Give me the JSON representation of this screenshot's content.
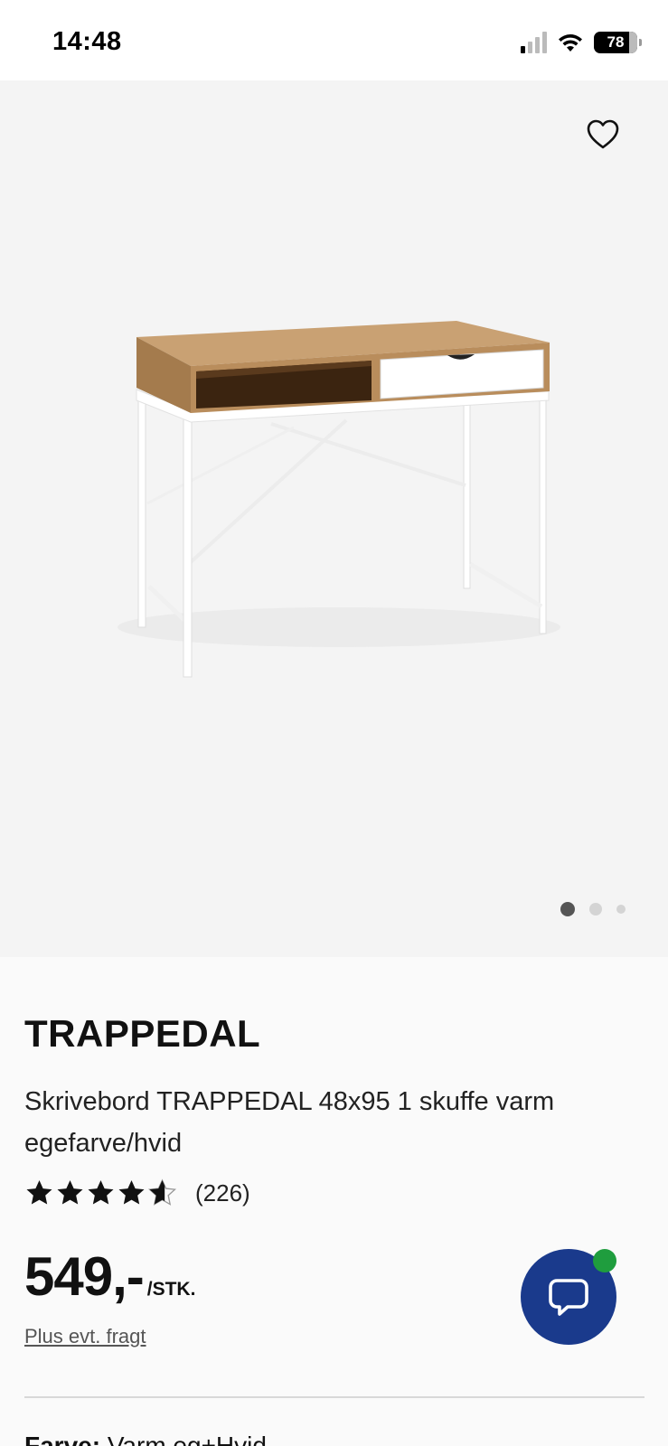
{
  "status_bar": {
    "time": "14:48",
    "battery": "78"
  },
  "product": {
    "name": "TRAPPEDAL",
    "description": "Skrivebord TRAPPEDAL 48x95 1 skuffe varm egefarve/hvid",
    "rating_stars": 4.5,
    "rating_count": "(226)",
    "price": "549,-",
    "price_unit": "/STK.",
    "shipping_link": "Plus evt. fragt",
    "color_label": "Farve:",
    "color_value": "Varm eg+Hvid"
  },
  "gallery": {
    "image_count": 3,
    "active_index": 0
  },
  "colors": {
    "chat_button": "#1a3a8c",
    "chat_status": "#1f9d3e",
    "hero_background": "#f4f4f4"
  },
  "icons": [
    "heart-icon",
    "chat-bubble-icon",
    "star-icon",
    "signal-icon",
    "wifi-icon",
    "battery-icon"
  ]
}
